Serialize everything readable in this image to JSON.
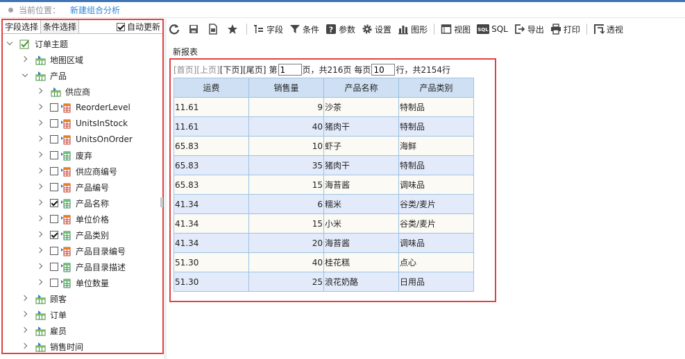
{
  "breadcrumb": {
    "label": "当前位置：",
    "current": "新建组合分析"
  },
  "left_panel": {
    "tabs": [
      {
        "label": "字段选择",
        "active": true
      },
      {
        "label": "条件选择",
        "active": false
      }
    ],
    "auto_update": {
      "label": "自动更新",
      "checked": true
    },
    "tree": [
      {
        "label": "订单主题",
        "level": 0,
        "expand": "down",
        "icon": "topic-icon",
        "checkbox": null
      },
      {
        "label": "地图区域",
        "level": 1,
        "expand": "right",
        "icon": "folder-table-icon",
        "checkbox": null
      },
      {
        "label": "产品",
        "level": 1,
        "expand": "down",
        "icon": "folder-table-icon",
        "checkbox": null
      },
      {
        "label": "供应商",
        "level": 2,
        "expand": "right",
        "icon": "folder-table-icon",
        "checkbox": null
      },
      {
        "label": "ReorderLevel",
        "level": 2,
        "expand": "right",
        "icon": "measure-field-icon",
        "checkbox": false
      },
      {
        "label": "UnitsInStock",
        "level": 2,
        "expand": "right",
        "icon": "measure-field-icon",
        "checkbox": false
      },
      {
        "label": "UnitsOnOrder",
        "level": 2,
        "expand": "right",
        "icon": "measure-field-icon",
        "checkbox": false
      },
      {
        "label": "废弃",
        "level": 2,
        "expand": "right",
        "icon": "dimension-field-icon",
        "checkbox": false
      },
      {
        "label": "供应商编号",
        "level": 2,
        "expand": "right",
        "icon": "measure-field-icon",
        "checkbox": false
      },
      {
        "label": "产品编号",
        "level": 2,
        "expand": "right",
        "icon": "measure-field-icon",
        "checkbox": false
      },
      {
        "label": "产品名称",
        "level": 2,
        "expand": "right",
        "icon": "dimension-field-icon",
        "checkbox": true
      },
      {
        "label": "单位价格",
        "level": 2,
        "expand": "right",
        "icon": "measure-field-icon",
        "checkbox": false
      },
      {
        "label": "产品类别",
        "level": 2,
        "expand": "right",
        "icon": "dimension-field-icon",
        "checkbox": true
      },
      {
        "label": "产品目录编号",
        "level": 2,
        "expand": "right",
        "icon": "measure-field-icon",
        "checkbox": false
      },
      {
        "label": "产品目录描述",
        "level": 2,
        "expand": "right",
        "icon": "dimension-field-icon",
        "checkbox": false
      },
      {
        "label": "单位数量",
        "level": 2,
        "expand": "right",
        "icon": "dimension-field-icon",
        "checkbox": false
      },
      {
        "label": "顾客",
        "level": 1,
        "expand": "right",
        "icon": "folder-table-icon",
        "checkbox": null
      },
      {
        "label": "订单",
        "level": 1,
        "expand": "right",
        "icon": "folder-table-icon",
        "checkbox": null
      },
      {
        "label": "雇员",
        "level": 1,
        "expand": "right",
        "icon": "folder-table-icon",
        "checkbox": null
      },
      {
        "label": "销售时间",
        "level": 1,
        "expand": "right",
        "icon": "folder-table-icon",
        "checkbox": null
      }
    ]
  },
  "toolbar": {
    "items": [
      {
        "name": "refresh",
        "label": "",
        "icon": "refresh-icon"
      },
      {
        "name": "save",
        "label": "",
        "icon": "save-icon"
      },
      {
        "name": "save-as",
        "label": "",
        "icon": "save-as-icon"
      },
      {
        "name": "favorite",
        "label": "",
        "icon": "star-icon"
      },
      {
        "name": "sep",
        "label": "",
        "icon": ""
      },
      {
        "name": "fields",
        "label": "字段",
        "icon": "fields-icon"
      },
      {
        "name": "condition",
        "label": "条件",
        "icon": "filter-icon"
      },
      {
        "name": "params",
        "label": "参数",
        "icon": "question-icon"
      },
      {
        "name": "settings",
        "label": "设置",
        "icon": "gear-icon"
      },
      {
        "name": "chart",
        "label": "图形",
        "icon": "bar-chart-icon"
      },
      {
        "name": "sep",
        "label": "",
        "icon": ""
      },
      {
        "name": "view",
        "label": "视图",
        "icon": "view-icon"
      },
      {
        "name": "sql",
        "label": "SQL",
        "icon": "sql-icon"
      },
      {
        "name": "export",
        "label": "导出",
        "icon": "export-icon"
      },
      {
        "name": "print",
        "label": "打印",
        "icon": "printer-icon"
      },
      {
        "name": "sep",
        "label": "",
        "icon": ""
      },
      {
        "name": "pivot",
        "label": "透视",
        "icon": "pivot-icon"
      }
    ]
  },
  "report": {
    "title": "新报表",
    "pager": {
      "first": "[首页]",
      "prev": "[上页]",
      "next": "[下页]",
      "last": "[尾页]",
      "page_prefix": "第",
      "page_value": "1",
      "page_suffix": "页，共216页",
      "rows_prefix": "每页",
      "rows_value": "10",
      "rows_suffix": "行，共2154行"
    },
    "columns": [
      "运费",
      "销售量",
      "产品名称",
      "产品类别"
    ],
    "rows": [
      [
        "11.61",
        "9",
        "沙茶",
        "特制品"
      ],
      [
        "11.61",
        "40",
        "猪肉干",
        "特制品"
      ],
      [
        "65.83",
        "10",
        "虾子",
        "海鲜"
      ],
      [
        "65.83",
        "35",
        "猪肉干",
        "特制品"
      ],
      [
        "65.83",
        "15",
        "海苔酱",
        "调味品"
      ],
      [
        "41.34",
        "6",
        "糯米",
        "谷类/麦片"
      ],
      [
        "41.34",
        "15",
        "小米",
        "谷类/麦片"
      ],
      [
        "41.34",
        "20",
        "海苔酱",
        "调味品"
      ],
      [
        "51.30",
        "40",
        "桂花糕",
        "点心"
      ],
      [
        "51.30",
        "25",
        "浪花奶酪",
        "日用品"
      ]
    ]
  },
  "colors": {
    "accent": "#2b86d9",
    "highlight_border": "#e24141",
    "header_bg": "#cfe0f4",
    "row_alt": "#e3ebfb"
  }
}
